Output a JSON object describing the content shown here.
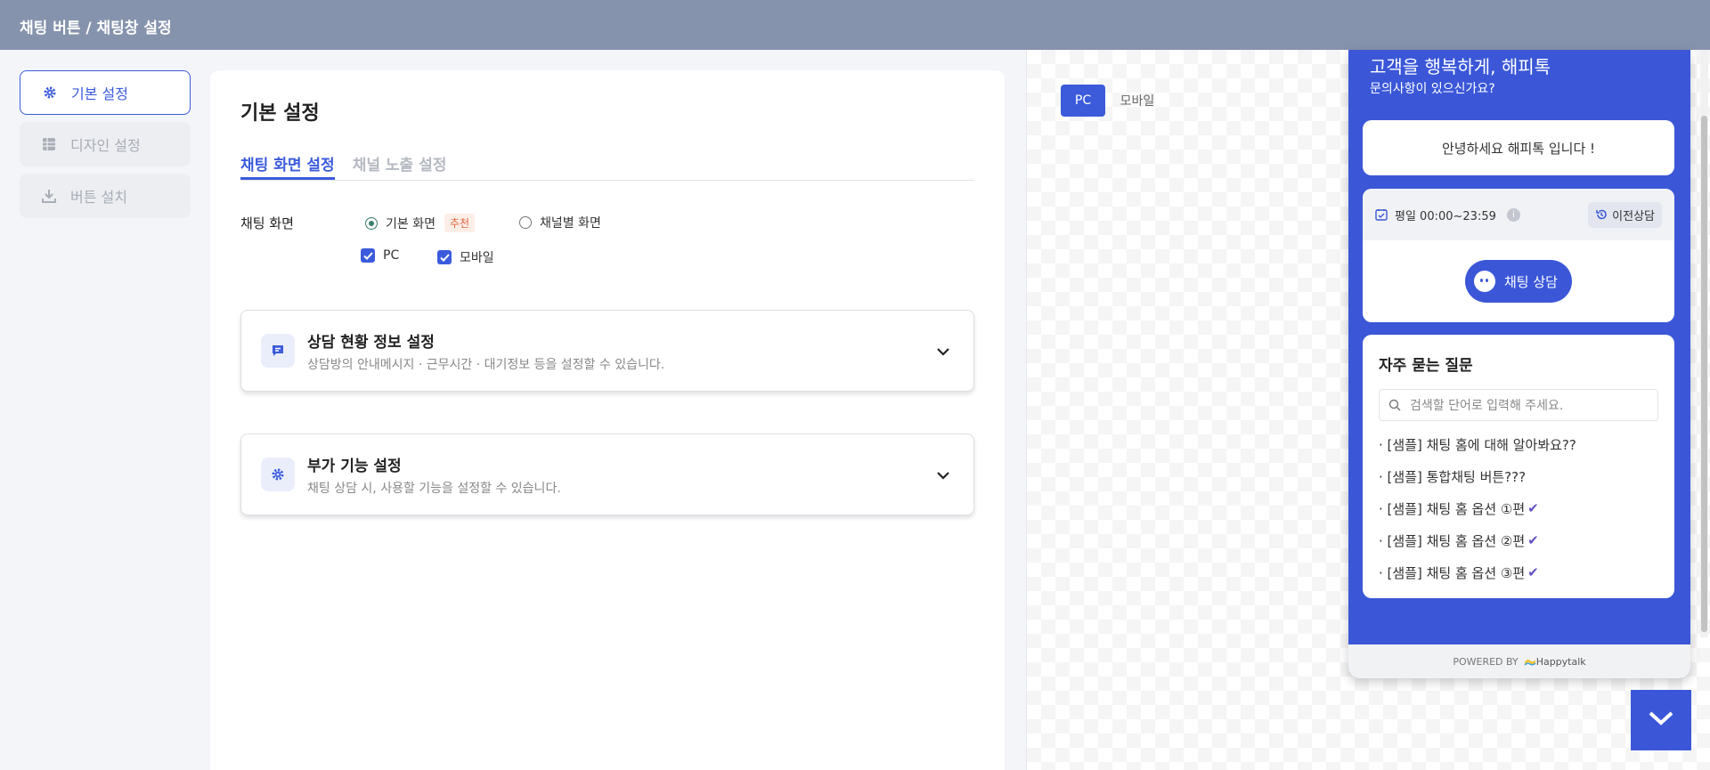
{
  "header": {
    "title": "채팅 버튼 / 채팅창 설정"
  },
  "sidebar": {
    "items": [
      {
        "label": "기본 설정",
        "icon": "gear-icon",
        "active": true
      },
      {
        "label": "디자인 설정",
        "icon": "grid-icon",
        "active": false
      },
      {
        "label": "버튼 설치",
        "icon": "download-icon",
        "active": false
      }
    ]
  },
  "main": {
    "title": "기본 설정",
    "tabs": [
      {
        "label": "채팅 화면 설정",
        "active": true
      },
      {
        "label": "채널 노출 설정",
        "active": false
      }
    ],
    "screen": {
      "label": "채팅 화면",
      "option_default": "기본 화면",
      "badge": "추천",
      "option_channel": "채널별 화면",
      "check_pc": "PC",
      "check_mobile": "모바일"
    },
    "cards": [
      {
        "title": "상담 현황 정보 설정",
        "desc": "상담방의 안내메시지 · 근무시간 · 대기정보 등을 설정할 수 있습니다.",
        "icon": "chat-icon"
      },
      {
        "title": "부가 기능 설정",
        "desc": "채팅 상담 시, 사용할 기능을 설정할 수 있습니다.",
        "icon": "gear-icon"
      }
    ]
  },
  "preview": {
    "device_pc": "PC",
    "device_mobile": "모바일",
    "widget": {
      "title": "고객을 행복하게, 해피톡",
      "subtitle": "문의사항이 있으신가요?",
      "greeting": "안녕하세요 해피톡 입니다 !",
      "hours": "평일 00:00~23:59",
      "info": "i",
      "prev_chat": "이전상담",
      "chat_button": "채팅 상담",
      "faq_title": "자주 묻는 질문",
      "search_placeholder": "검색할 단어로 입력해 주세요.",
      "faq_items": [
        "· [샘플] 채팅 홈에 대해 알아봐요??",
        "· [샘플] 통합채팅 버튼???",
        "· [샘플] 채팅 홈 옵션 ①편",
        "· [샘플] 채팅 홈 옵션 ②편",
        "· [샘플] 채팅 홈 옵션 ③편"
      ],
      "tick": "✔",
      "powered_by": "POWERED BY",
      "brand": "Happytalk"
    }
  },
  "colors": {
    "accent": "#3b5bdb",
    "widget": "#3b57d8",
    "topbar": "#8693ad"
  }
}
